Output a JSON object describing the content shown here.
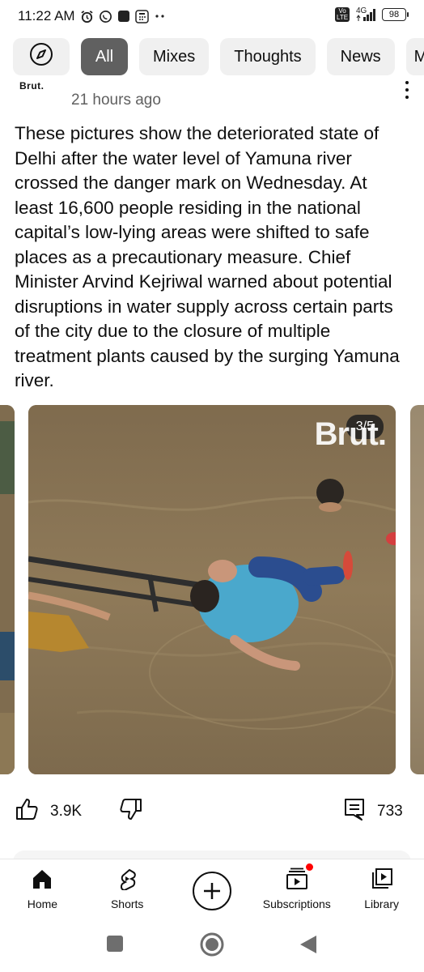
{
  "status_bar": {
    "time": "11:22 AM",
    "network": "4G",
    "battery": "98"
  },
  "chips": {
    "explore_icon": "compass-icon",
    "items": [
      "All",
      "Mixes",
      "Thoughts",
      "News",
      "M"
    ],
    "selected": "All"
  },
  "post": {
    "channel": "Brut.",
    "time_ago": "21 hours ago",
    "text": "These pictures show the deteriorated state of Delhi after the water level of Yamuna river crossed the danger mark on Wednesday. At least 16,600 people residing in the national capital’s low-lying areas were shifted to safe places as a precautionary measure. Chief Minister Arvind Kejriwal warned about potential disruptions in water supply across certain parts of the city due to the closure of multiple treatment plants caused by the surging Yamuna river.",
    "image_watermark": "Brut.",
    "image_counter": "3/5"
  },
  "actions": {
    "likes": "3.9K",
    "comments": "733"
  },
  "bottom_nav": {
    "home": "Home",
    "shorts": "Shorts",
    "subscriptions": "Subscriptions",
    "library": "Library"
  },
  "colors": {
    "chip_active_bg": "#606060",
    "chip_bg": "#f0f0f0",
    "notification_dot": "#ff0000",
    "secondary_text": "#606060"
  }
}
